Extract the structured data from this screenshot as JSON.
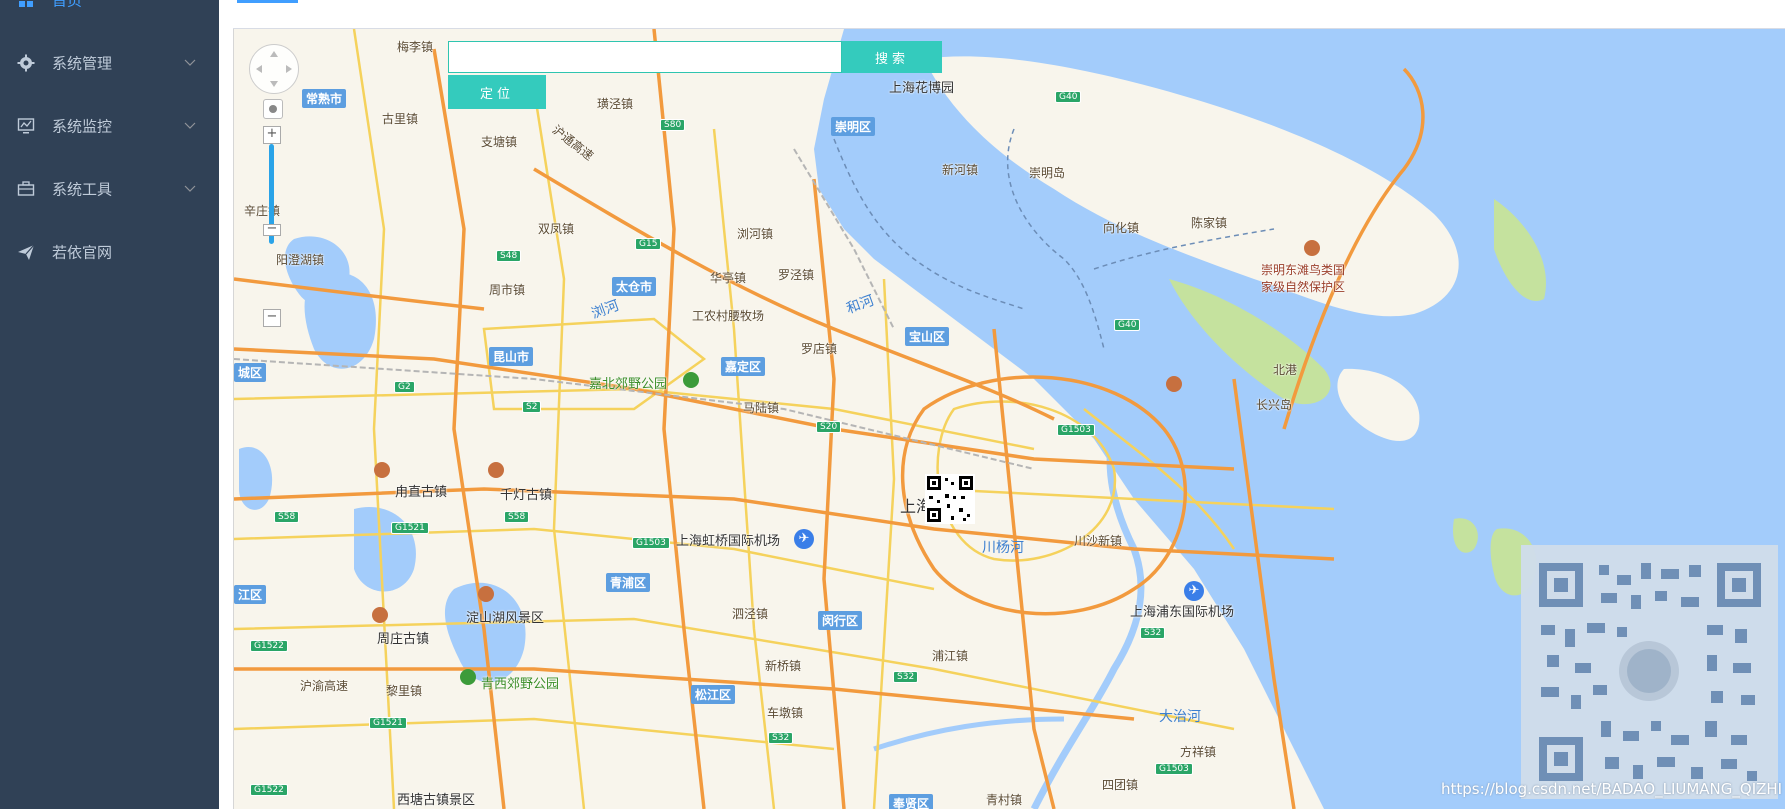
{
  "sidebar": {
    "top_item": {
      "label": "首页"
    },
    "items": [
      {
        "label": "系统管理",
        "icon": "gear-icon"
      },
      {
        "label": "系统监控",
        "icon": "monitor-icon"
      },
      {
        "label": "系统工具",
        "icon": "toolbox-icon"
      },
      {
        "label": "若依官网",
        "icon": "send-icon"
      }
    ]
  },
  "search": {
    "placeholder": "",
    "value": "",
    "button_label": "搜索"
  },
  "locate": {
    "button_label": "定位"
  },
  "map": {
    "place_labels": [
      "梅李镇",
      "上海花博园",
      "崇明岛",
      "新河镇",
      "向化镇",
      "陈家镇",
      "崇明东滩鸟类国",
      "家级自然保护区",
      "长兴岛",
      "北港",
      "璜泾镇",
      "古里镇",
      "支塘镇",
      "沪通高速",
      "双凤镇",
      "浏河镇",
      "辛庄镇",
      "阳澄湖镇",
      "周市镇",
      "华亭镇",
      "罗泾镇",
      "工农村腰牧场",
      "罗店镇",
      "嘉北郊野公园",
      "马陆镇",
      "甪直古镇",
      "千灯古镇",
      "上海虹桥国际机场",
      "川杨河",
      "川沙新镇",
      "上海浦东国际机场",
      "淀山湖风景区",
      "周庄古镇",
      "泗泾镇",
      "新桥镇",
      "浦江镇",
      "青西郊野公园",
      "沪渝高速",
      "黎里镇",
      "车墩镇",
      "大治河",
      "方祥镇",
      "四团镇",
      "青村镇",
      "西塘古镇景区",
      "浏河",
      "和河",
      "上海"
    ],
    "districts": [
      "常熟市",
      "崇明区",
      "太仓市",
      "宝山区",
      "昆山市",
      "嘉定区",
      "青浦区",
      "闵行区",
      "松江区",
      "奉贤区",
      "城区",
      "江区"
    ],
    "shields": [
      "G40",
      "S80",
      "G15",
      "S48",
      "G40",
      "G2",
      "S2",
      "S20",
      "G1503",
      "S58",
      "G1521",
      "S58",
      "G1503",
      "G1522",
      "G1521",
      "S32",
      "S32",
      "S32",
      "G1503",
      "G1522"
    ]
  },
  "watermark": "https://blog.csdn.net/BADAO_LIUMANG_QIZHI",
  "colors": {
    "sidebar_bg": "#304156",
    "sidebar_text": "#bfcbd9",
    "active_text": "#409eff",
    "button_teal": "#34cbbd",
    "water": "#a3ccfb",
    "land": "#f8f5ec",
    "highway": "#f29a3e"
  }
}
